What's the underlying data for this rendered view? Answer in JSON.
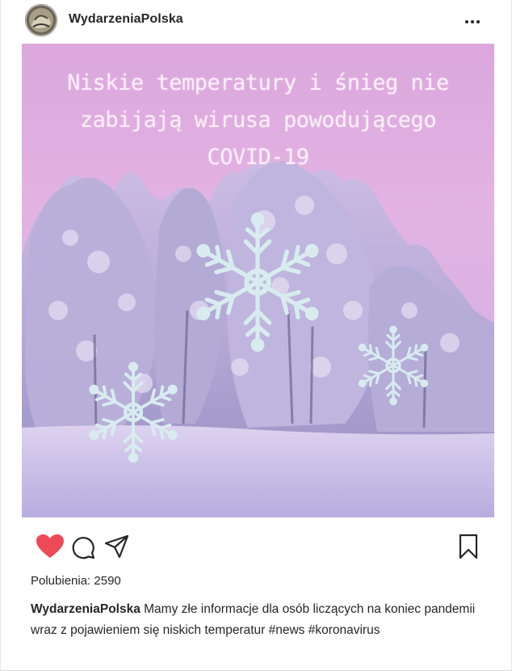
{
  "post": {
    "username": "WydarzeniaPolska",
    "image": {
      "overlay_lines": [
        "Niskie temperatury i śnieg nie",
        "zabijają wirusa powodującego",
        "COVID-19"
      ]
    },
    "actions": {
      "like_icon": "heart-icon",
      "comment_icon": "comment-icon",
      "share_icon": "send-icon",
      "save_icon": "bookmark-icon",
      "liked": true,
      "like_color": "#ed4956"
    },
    "likes_text": "Polubienia: 2590",
    "caption": {
      "user": "WydarzeniaPolska",
      "text": " Mamy złe informacje dla osób liczących na koniec pandemii wraz z pojawieniem się niskich temperatur #news #koronavirus"
    },
    "more_icon": "more-horizontal-icon"
  }
}
